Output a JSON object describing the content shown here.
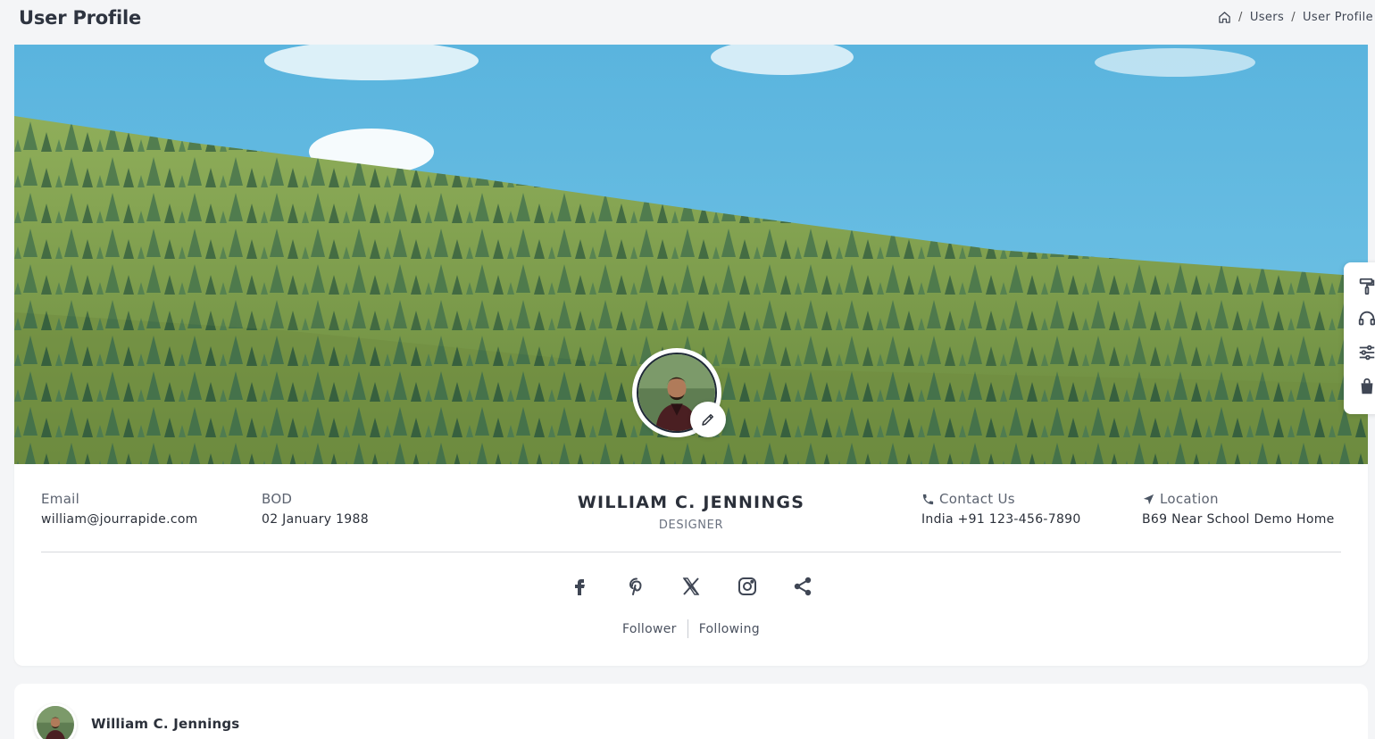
{
  "page": {
    "title": "User Profile"
  },
  "breadcrumb": {
    "home_icon": "home-icon",
    "separator": "/",
    "items": [
      "Users",
      "User Profile"
    ]
  },
  "profile": {
    "name": "WILLIAM C. JENNINGS",
    "role": "DESIGNER",
    "email": {
      "label": "Email",
      "value": "william@jourrapide.com"
    },
    "bod": {
      "label": "BOD",
      "value": "02 January 1988"
    },
    "contact": {
      "label": "Contact Us",
      "value": "India +91 123-456-7890",
      "icon": "phone-icon"
    },
    "location": {
      "label": "Location",
      "value": "B69 Near School Demo Home",
      "icon": "location-arrow-icon"
    },
    "edit_icon": "pencil-icon"
  },
  "socials": [
    "facebook-icon",
    "pinterest-icon",
    "x-icon",
    "instagram-icon",
    "share-icon"
  ],
  "follow": {
    "follower_label": "Follower",
    "following_label": "Following"
  },
  "side_panel": {
    "icons": [
      "paint-roller-icon",
      "headset-icon",
      "sliders-icon",
      "shopping-bag-icon"
    ]
  },
  "post": {
    "author": "William C. Jennings"
  },
  "colors": {
    "background": "#f4f5f7",
    "card": "#ffffff",
    "text": "#2b303a",
    "muted": "#6b7280",
    "sky": "#5bb6dc",
    "hill": "#7c9a4a",
    "tree": "#3d6b4a"
  }
}
